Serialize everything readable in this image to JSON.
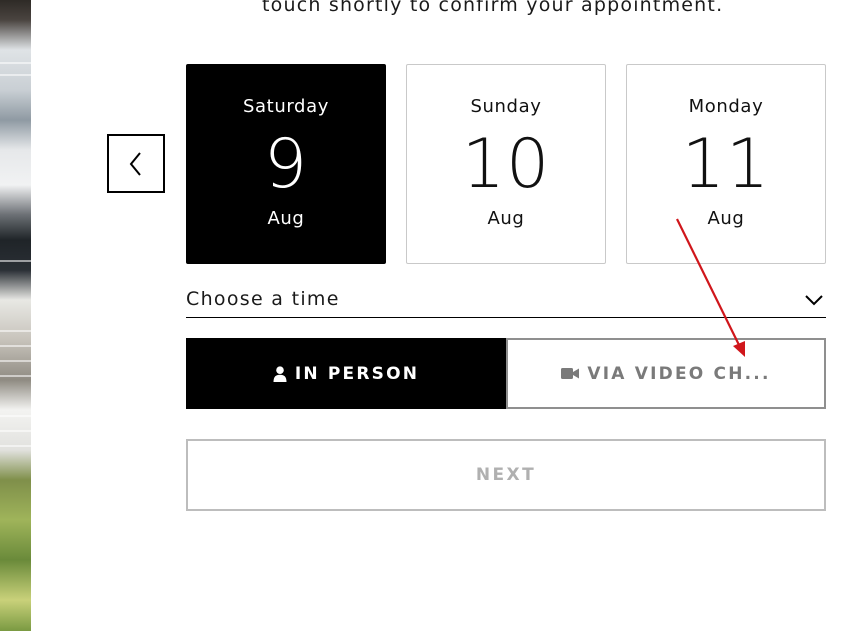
{
  "intro": {
    "text": "touch shortly to confirm your appointment."
  },
  "nav": {
    "prev_icon": "chevron-left-icon"
  },
  "days": [
    {
      "weekday": "Saturday",
      "day": "9",
      "month": "Aug",
      "selected": true
    },
    {
      "weekday": "Sunday",
      "day": "10",
      "month": "Aug",
      "selected": false
    },
    {
      "weekday": "Monday",
      "day": "11",
      "month": "Aug",
      "selected": false
    }
  ],
  "time_select": {
    "placeholder": "Choose a time",
    "icon": "chevron-down-icon"
  },
  "modes": {
    "in_person": {
      "label": "IN PERSON",
      "icon": "user-icon",
      "selected": true
    },
    "video": {
      "label": "VIA VIDEO CH...",
      "icon": "video-camera-icon",
      "selected": false
    }
  },
  "next": {
    "label": "NEXT"
  },
  "colors": {
    "selected_bg": "#000000",
    "selected_text": "#ffffff",
    "muted_text": "#7a7a7a",
    "disabled_text": "#b0b0b0",
    "annotation_arrow": "#d0161b"
  }
}
